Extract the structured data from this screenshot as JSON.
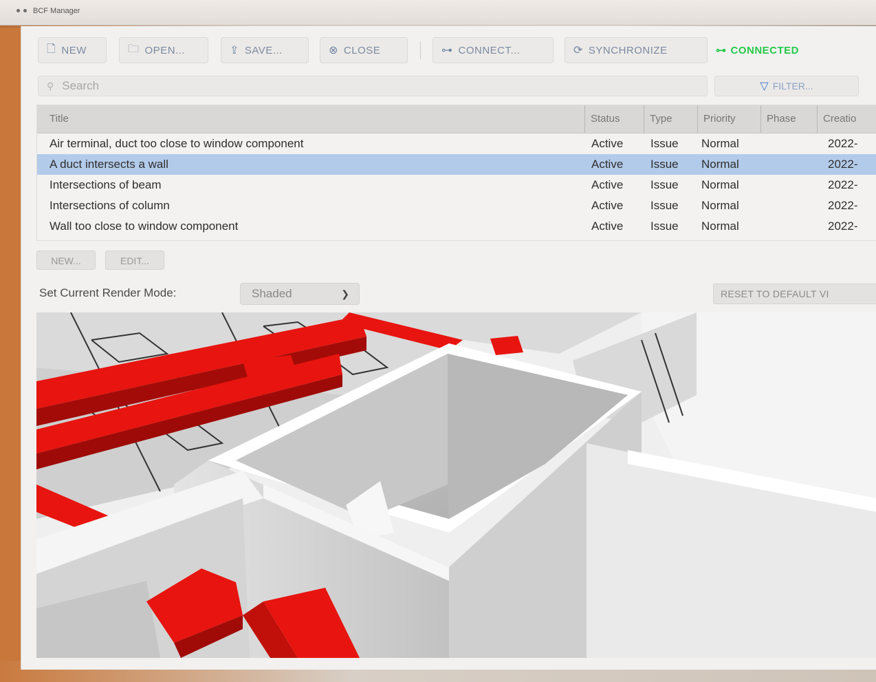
{
  "window": {
    "title": "BCF Manager"
  },
  "toolbar": {
    "new_label": "NEW",
    "open_label": "OPEN...",
    "save_label": "SAVE...",
    "close_label": "CLOSE",
    "connect_label": "CONNECT...",
    "sync_label": "SYNCHRONIZE",
    "status_label": "CONNECTED",
    "icons": [
      "new-file-icon",
      "open-folder-icon",
      "save-icon",
      "close-icon",
      "connect-icon",
      "sync-icon",
      "connected-icon"
    ]
  },
  "search": {
    "placeholder": "Search",
    "value": ""
  },
  "filter": {
    "label": "FILTER..."
  },
  "table": {
    "headers": [
      "Title",
      "Status",
      "Type",
      "Priority",
      "Phase",
      "Creatio"
    ],
    "rows": [
      {
        "title": "Air terminal, duct too close to window component",
        "status": "Active",
        "type": "Issue",
        "priority": "Normal",
        "phase": "",
        "created": "2022-"
      },
      {
        "title": "A duct intersects a wall",
        "status": "Active",
        "type": "Issue",
        "priority": "Normal",
        "phase": "",
        "created": "2022-"
      },
      {
        "title": "Intersections of beam",
        "status": "Active",
        "type": "Issue",
        "priority": "Normal",
        "phase": "",
        "created": "2022-"
      },
      {
        "title": "Intersections of column",
        "status": "Active",
        "type": "Issue",
        "priority": "Normal",
        "phase": "",
        "created": "2022-"
      },
      {
        "title": "Wall too close to window component",
        "status": "Active",
        "type": "Issue",
        "priority": "Normal",
        "phase": "",
        "created": "2022-"
      }
    ],
    "selected_index": 1
  },
  "actions": {
    "new_label": "NEW...",
    "edit_label": "EDIT..."
  },
  "render_mode": {
    "label": "Set Current Render Mode:",
    "selected": "Shaded"
  },
  "reset_view": {
    "label": "RESET TO DEFAULT VI"
  },
  "colors": {
    "accent": "#3a73c9",
    "connected": "#27c84a",
    "selection": "#b3cbea",
    "duct": "#e8140f"
  }
}
